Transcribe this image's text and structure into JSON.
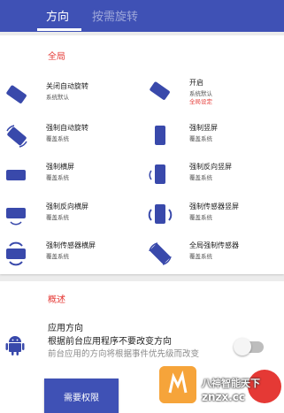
{
  "tabs": [
    {
      "label": "方向",
      "active": true
    },
    {
      "label": "按需旋转",
      "active": false
    }
  ],
  "global_section": {
    "title": "全局",
    "items": [
      {
        "title": "关闭自动旋转",
        "sub": "系统默认",
        "icon": "phone-tilted-icon"
      },
      {
        "title": "开启",
        "sub": "系统默认",
        "sub2": "全局设定",
        "icon": "phone-tilted-icon"
      },
      {
        "title": "强制自动旋转",
        "sub": "覆盖系统",
        "icon": "phone-auto-rotate-icon"
      },
      {
        "title": "强制竖屏",
        "sub": "覆盖系统",
        "icon": "phone-portrait-icon"
      },
      {
        "title": "强制横屏",
        "sub": "覆盖系统",
        "icon": "phone-landscape-icon"
      },
      {
        "title": "强制反向竖屏",
        "sub": "覆盖系统",
        "icon": "phone-portrait-reverse-icon"
      },
      {
        "title": "强制反向横屏",
        "sub": "覆盖系统",
        "icon": "phone-landscape-reverse-icon"
      },
      {
        "title": "强制传感器竖屏",
        "sub": "覆盖系统",
        "icon": "phone-portrait-sensor-icon"
      },
      {
        "title": "强制传感器横屏",
        "sub": "覆盖系统",
        "icon": "phone-landscape-sensor-icon"
      },
      {
        "title": "全局强制传感器",
        "sub": "覆盖系统",
        "icon": "phone-sensor-icon"
      }
    ]
  },
  "overview_section": {
    "title": "概述",
    "app_direction": {
      "title": "应用方向",
      "description": "根据前台应用程序不要改变方向",
      "note": "前台应用的方向将根据事件优先级而改变",
      "toggle_on": false
    },
    "permission_button": "需要权限"
  },
  "watermark": {
    "text1": "八神智能天下",
    "text2": "znzx.cc"
  },
  "colors": {
    "primary": "#3f51b5",
    "accent": "#e53935",
    "icon": "#3949ab"
  }
}
